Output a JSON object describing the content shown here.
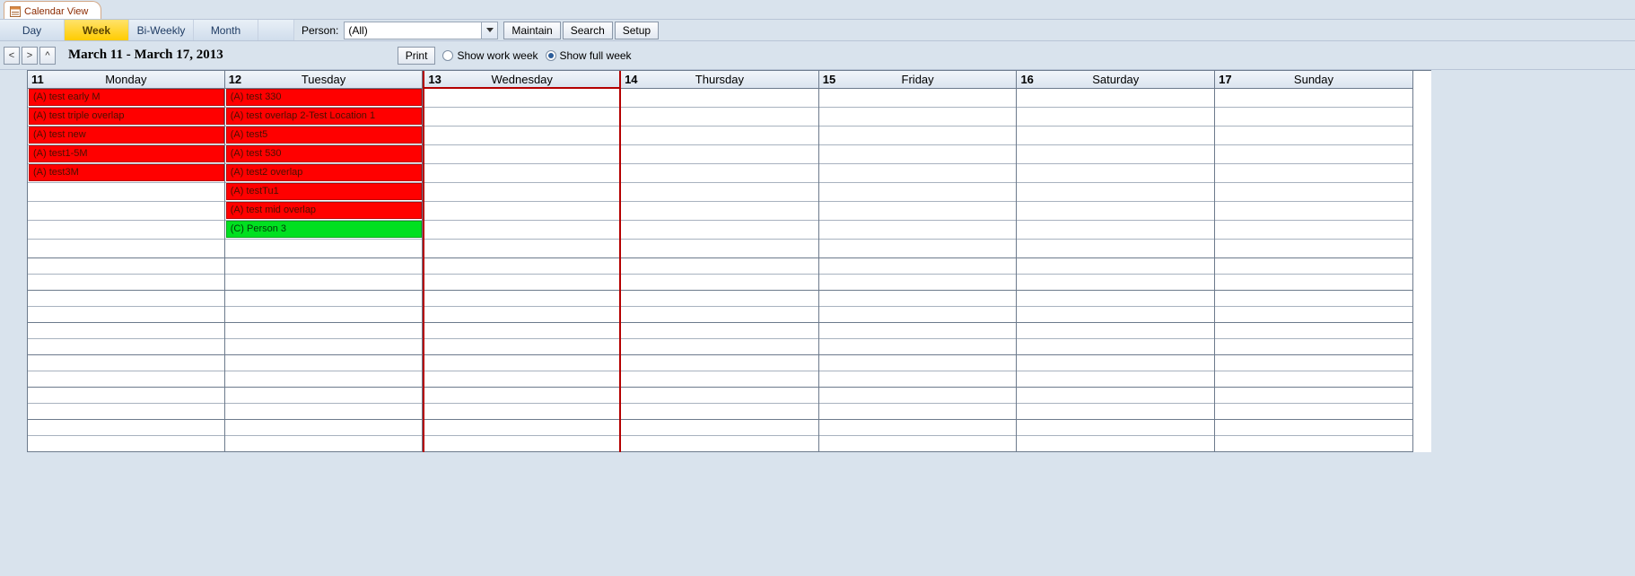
{
  "tab": {
    "title": "Calendar View"
  },
  "modes": {
    "day": "Day",
    "week": "Week",
    "biweekly": "Bi-Weekly",
    "month": "Month",
    "active": "week"
  },
  "person": {
    "label": "Person:",
    "value": "(All)"
  },
  "buttons": {
    "maintain": "Maintain",
    "search": "Search",
    "setup": "Setup",
    "print": "Print"
  },
  "nav": {
    "prev": "<",
    "next": ">",
    "up": "^"
  },
  "date_range": "March 11 - March 17, 2013",
  "radios": {
    "work_week": "Show work week",
    "full_week": "Show full week",
    "selected": "full_week"
  },
  "days": [
    {
      "num": "11",
      "name": "Monday"
    },
    {
      "num": "12",
      "name": "Tuesday"
    },
    {
      "num": "13",
      "name": "Wednesday"
    },
    {
      "num": "14",
      "name": "Thursday"
    },
    {
      "num": "15",
      "name": "Friday"
    },
    {
      "num": "16",
      "name": "Saturday"
    },
    {
      "num": "17",
      "name": "Sunday"
    }
  ],
  "events": {
    "monday": [
      {
        "label": "(A) test early M",
        "color": "red"
      },
      {
        "label": "(A) test triple overlap",
        "color": "red"
      },
      {
        "label": "(A) test new",
        "color": "red"
      },
      {
        "label": "(A) test1-5M",
        "color": "red"
      },
      {
        "label": "(A) test3M",
        "color": "red"
      }
    ],
    "tuesday": [
      {
        "label": "(A) test 330",
        "color": "red"
      },
      {
        "label": "(A) test overlap 2-Test Location 1",
        "color": "red"
      },
      {
        "label": "(A) test5",
        "color": "red"
      },
      {
        "label": "(A) test 530",
        "color": "red"
      },
      {
        "label": "(A) test2 overlap",
        "color": "red"
      },
      {
        "label": "(A) testTu1",
        "color": "red"
      },
      {
        "label": "(A) test mid overlap",
        "color": "red"
      },
      {
        "label": "(C) Person 3",
        "color": "green"
      }
    ]
  },
  "slot_count_top": 9,
  "slot_rows_bottom": 12
}
